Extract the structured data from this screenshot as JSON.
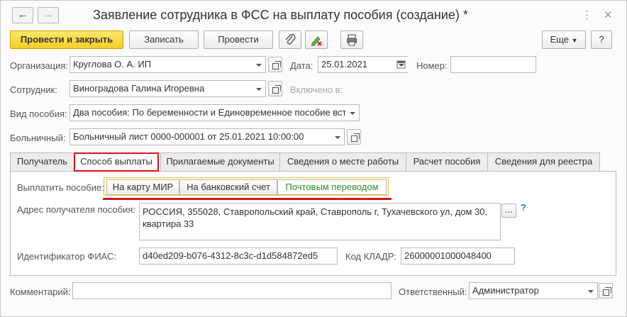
{
  "window": {
    "title": "Заявление сотрудника в ФСС на выплату пособия (создание) *"
  },
  "toolbar": {
    "post_close": "Провести и закрыть",
    "save": "Записать",
    "post": "Провести",
    "more": "Еще",
    "help": "?"
  },
  "form": {
    "org_label": "Организация:",
    "org_value": "Круглова О. А. ИП",
    "date_label": "Дата:",
    "date_value": "25.01.2021",
    "number_label": "Номер:",
    "number_value": "",
    "employee_label": "Сотрудник:",
    "employee_value": "Виноградова Галина Игоревна",
    "included_label": "Включено в:",
    "benefit_label": "Вид пособия:",
    "benefit_value": "Два пособия: По беременности и Единовременное пособие вст",
    "sick_label": "Больничный:",
    "sick_value": "Больничный лист 0000-000001 от 25.01.2021 10:00:00",
    "comment_label": "Комментарий:",
    "comment_value": "",
    "responsible_label": "Ответственный:",
    "responsible_value": "Администратор"
  },
  "tabs": [
    {
      "label": "Получатель"
    },
    {
      "label": "Способ выплаты"
    },
    {
      "label": "Прилагаемые документы"
    },
    {
      "label": "Сведения о месте работы"
    },
    {
      "label": "Расчет пособия"
    },
    {
      "label": "Сведения для реестра"
    }
  ],
  "payment": {
    "pay_label": "Выплатить пособие:",
    "options": [
      "На карту МИР",
      "На банковский счет",
      "Почтовым переводом"
    ],
    "selected": "Почтовым переводом",
    "address_label": "Адрес получателя пособия:",
    "address_line1": "РОССИЯ, 355028, Ставропольский край, Ставрополь г, Тухачевского ул, дом 30,",
    "address_line2": "квартира 33",
    "ellipsis": "...",
    "help": "?",
    "fias_label": "Идентификатор ФИАС:",
    "fias_value": "d40ed209-b076-4312-8c3c-d1d584872ed5",
    "kladr_label": "Код КЛАДР:",
    "kladr_value": "26000001000048400"
  },
  "colors": {
    "accent_red": "#d2181b",
    "primary_yellow": "#f6cd27",
    "selected_green": "#2e8b2e"
  }
}
